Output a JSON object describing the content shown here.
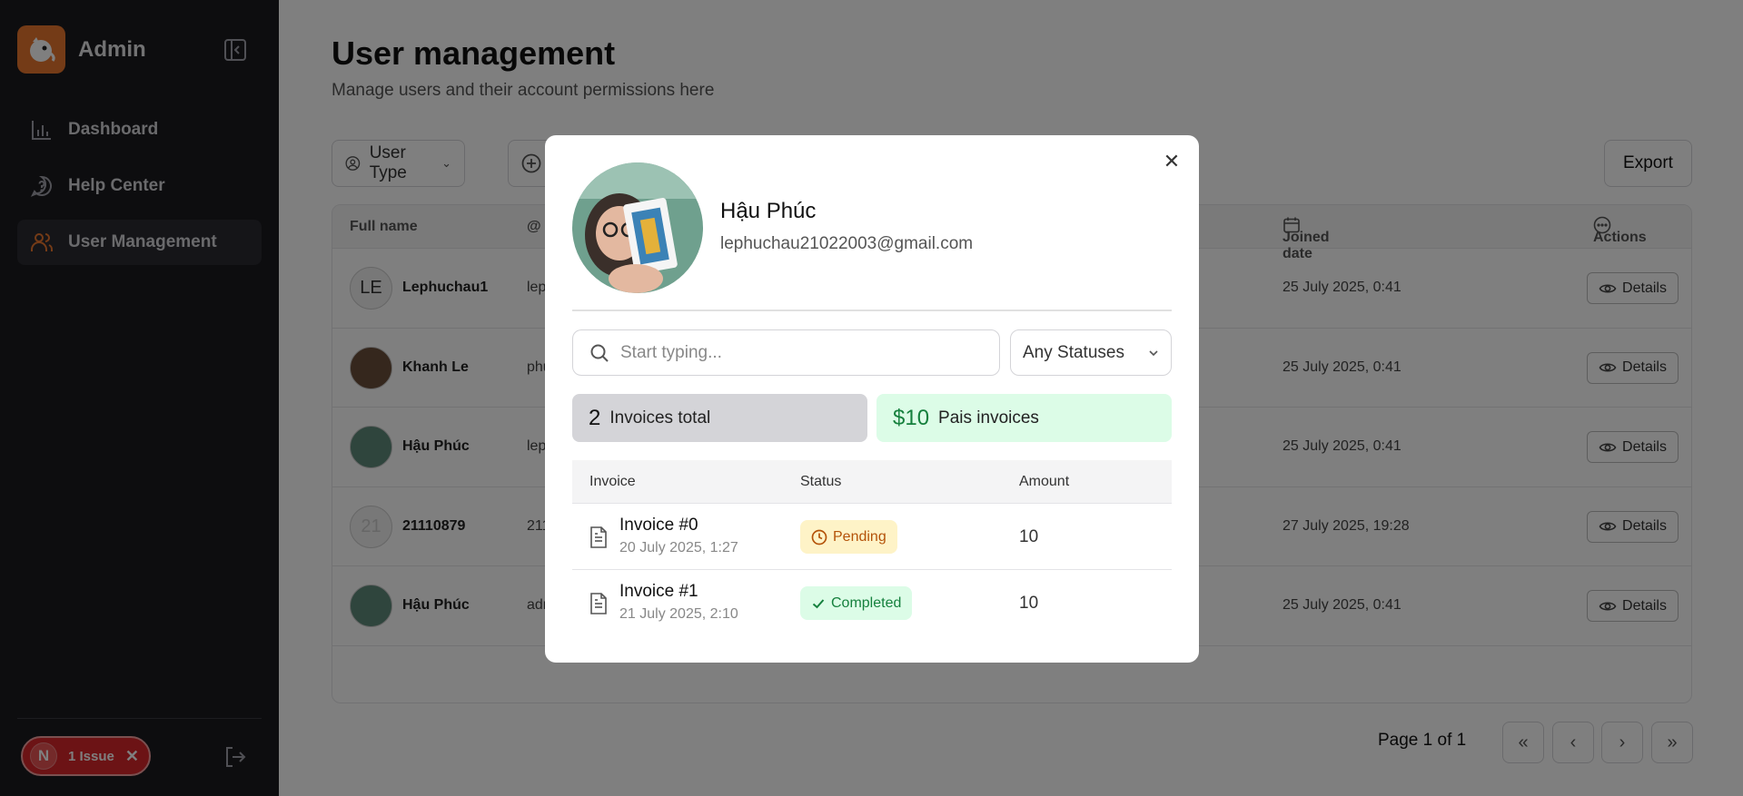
{
  "sidebar": {
    "brand": "Admin",
    "items": [
      {
        "label": "Dashboard",
        "icon": "chart-icon"
      },
      {
        "label": "Help Center",
        "icon": "chat-help-icon"
      },
      {
        "label": "User Management",
        "icon": "users-icon"
      }
    ],
    "issue": {
      "avatar": "N",
      "label": "1 Issue"
    }
  },
  "main": {
    "title": "User management",
    "subtitle": "Manage users and their account permissions here",
    "filter_user_type": "User Type",
    "export_label": "Export",
    "columns": {
      "full_name": "Full name",
      "joined_date": "Joined date",
      "actions": "Actions"
    },
    "rows": [
      {
        "avatar": "LE",
        "name": "Lephuchau1",
        "email": "lep",
        "joined": "25 July 2025, 0:41",
        "action": "Details"
      },
      {
        "avatar": "",
        "name": "Khanh Le",
        "email": "phu",
        "joined": "25 July 2025, 0:41",
        "action": "Details"
      },
      {
        "avatar": "",
        "name": "Hậu Phúc",
        "email": "lep",
        "joined": "25 July 2025, 0:41",
        "action": "Details"
      },
      {
        "avatar": "21",
        "name": "21110879",
        "email": "211",
        "joined": "27 July 2025, 19:28",
        "action": "Details"
      },
      {
        "avatar": "",
        "name": "Hậu Phúc",
        "email": "adr",
        "joined": "25 July 2025, 0:41",
        "action": "Details"
      }
    ],
    "pagination": {
      "label": "Page 1 of 1"
    }
  },
  "modal": {
    "name": "Hậu Phúc",
    "email": "lephuchau21022003@gmail.com",
    "search_placeholder": "Start typing...",
    "status_filter": "Any Statuses",
    "total_count": "2",
    "total_label": "Invoices total",
    "paid_amount": "$10",
    "paid_label": "Pais invoices",
    "columns": {
      "invoice": "Invoice",
      "status": "Status",
      "amount": "Amount"
    },
    "invoices": [
      {
        "title": "Invoice #0",
        "date": "20 July 2025, 1:27",
        "status": "Pending",
        "amount": "10"
      },
      {
        "title": "Invoice #1",
        "date": "21 July 2025, 2:10",
        "status": "Completed",
        "amount": "10"
      }
    ]
  },
  "colors": {
    "accent": "#e8772e",
    "sidebar_bg": "#1a1a1f",
    "issue_red": "#d9262b",
    "paid_green": "#15803d",
    "pending_amber": "#b45309"
  }
}
